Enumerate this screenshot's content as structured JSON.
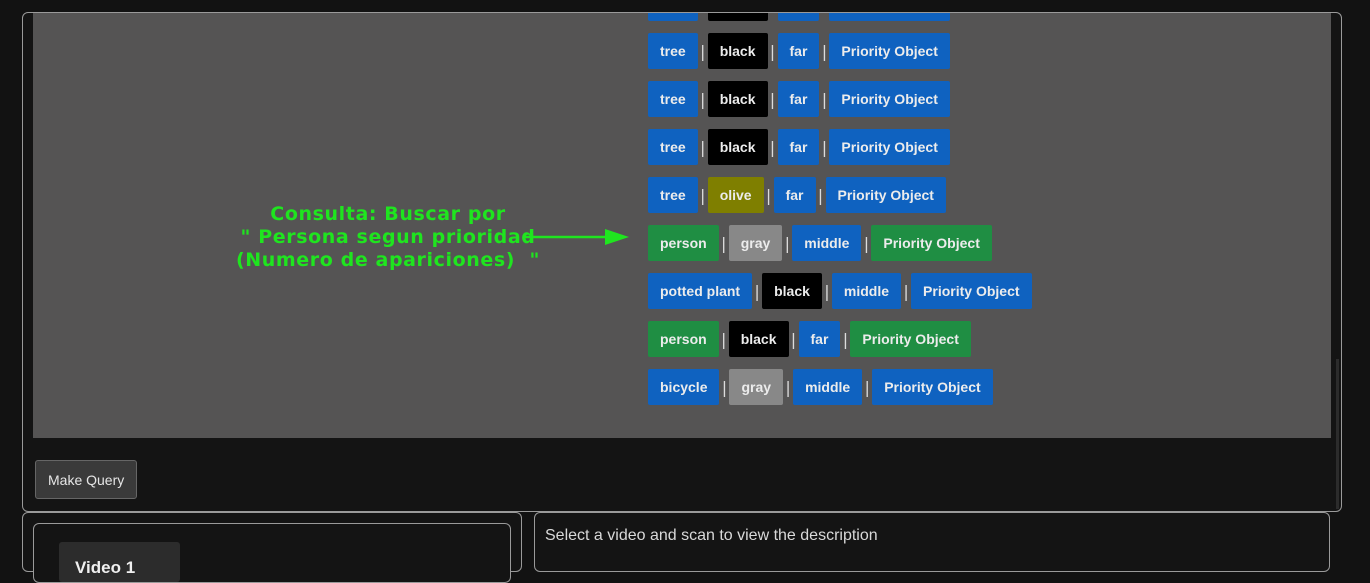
{
  "colors": {
    "blue": "#0f62c0",
    "green": "#1f8e43",
    "black": "#000000",
    "olive": "#7f7f00",
    "gray": "#888888",
    "annotation": "#1fe51f"
  },
  "results": [
    {
      "tags": [
        {
          "text": "tree",
          "color": "blue"
        },
        {
          "text": "black",
          "color": "black"
        },
        {
          "text": "far",
          "color": "blue"
        },
        {
          "text": "Priority Object",
          "color": "blue"
        }
      ]
    },
    {
      "tags": [
        {
          "text": "tree",
          "color": "blue"
        },
        {
          "text": "black",
          "color": "black"
        },
        {
          "text": "far",
          "color": "blue"
        },
        {
          "text": "Priority Object",
          "color": "blue"
        }
      ]
    },
    {
      "tags": [
        {
          "text": "tree",
          "color": "blue"
        },
        {
          "text": "black",
          "color": "black"
        },
        {
          "text": "far",
          "color": "blue"
        },
        {
          "text": "Priority Object",
          "color": "blue"
        }
      ]
    },
    {
      "tags": [
        {
          "text": "tree",
          "color": "blue"
        },
        {
          "text": "black",
          "color": "black"
        },
        {
          "text": "far",
          "color": "blue"
        },
        {
          "text": "Priority Object",
          "color": "blue"
        }
      ]
    },
    {
      "tags": [
        {
          "text": "tree",
          "color": "blue"
        },
        {
          "text": "olive",
          "color": "olive"
        },
        {
          "text": "far",
          "color": "blue"
        },
        {
          "text": "Priority Object",
          "color": "blue"
        }
      ]
    },
    {
      "tags": [
        {
          "text": "person",
          "color": "green"
        },
        {
          "text": "gray",
          "color": "gray"
        },
        {
          "text": "middle",
          "color": "blue"
        },
        {
          "text": "Priority Object",
          "color": "green"
        }
      ]
    },
    {
      "tags": [
        {
          "text": "potted plant",
          "color": "blue"
        },
        {
          "text": "black",
          "color": "black"
        },
        {
          "text": "middle",
          "color": "blue"
        },
        {
          "text": "Priority Object",
          "color": "blue"
        }
      ]
    },
    {
      "tags": [
        {
          "text": "person",
          "color": "green"
        },
        {
          "text": "black",
          "color": "black"
        },
        {
          "text": "far",
          "color": "blue"
        },
        {
          "text": "Priority Object",
          "color": "green"
        }
      ]
    },
    {
      "tags": [
        {
          "text": "bicycle",
          "color": "blue"
        },
        {
          "text": "gray",
          "color": "gray"
        },
        {
          "text": "middle",
          "color": "blue"
        },
        {
          "text": "Priority Object",
          "color": "blue"
        }
      ]
    }
  ],
  "annotation": {
    "line1": "Consulta: Buscar por",
    "line2": "\" Persona segun prioridad",
    "line3": "(Numero de apariciones)  \""
  },
  "separator": "|",
  "make_query_label": "Make Query",
  "video_tab_label": "Video 1",
  "description_placeholder": "Select a video and scan to view the description"
}
